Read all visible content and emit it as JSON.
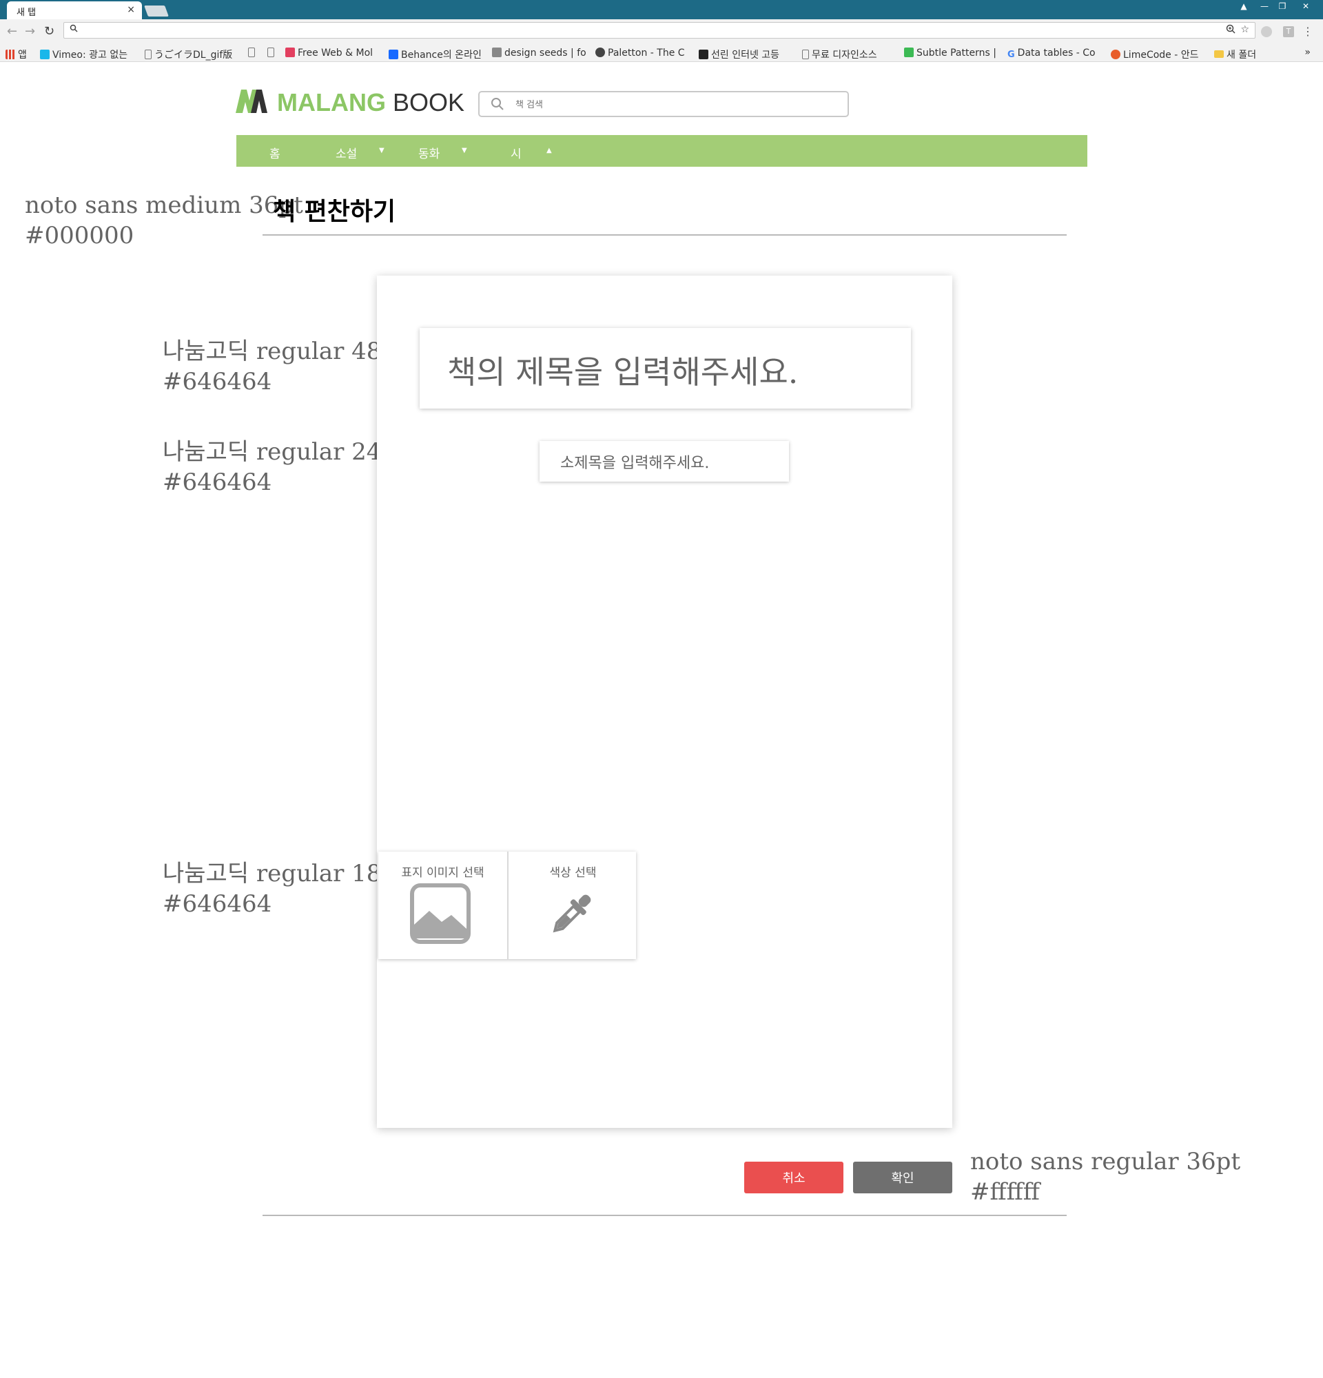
{
  "browser": {
    "tab_title": "새 탭",
    "tab_close": "×",
    "window_controls": [
      "▲",
      "—",
      "❐",
      "✕"
    ],
    "bookmarks": [
      {
        "label": "앱",
        "icon": "apps-grid-icon",
        "color": "#e0442e"
      },
      {
        "label": "Vimeo: 광고 없는",
        "icon": "vimeo-icon",
        "color": "#1ab7ea"
      },
      {
        "label": "うごイラDL_gif版",
        "icon": "page-icon",
        "color": "#ffffff"
      },
      {
        "label": "",
        "icon": "page-icon",
        "color": "#ffffff"
      },
      {
        "label": "Free Web & Mol",
        "icon": "invision-icon",
        "color": "#e23f5f"
      },
      {
        "label": "Behance의 온라인",
        "icon": "behance-icon",
        "color": "#1769ff"
      },
      {
        "label": "design seeds | fo",
        "icon": "design-seeds-icon",
        "color": "#888888"
      },
      {
        "label": "Paletton - The C",
        "icon": "paletton-icon",
        "color": "#444444"
      },
      {
        "label": "선린 인터넷 고등",
        "icon": "sunrin-icon",
        "color": "#222222"
      },
      {
        "label": "무료 디자인소스",
        "icon": "page-icon",
        "color": "#ffffff"
      },
      {
        "label": "Subtle Patterns |",
        "icon": "subtle-patterns-icon",
        "color": "#3cba54"
      },
      {
        "label": "Data tables - Co",
        "icon": "google-icon",
        "color": "#ffffff"
      },
      {
        "label": "LimeCode - 안드",
        "icon": "limecode-icon",
        "color": "#e85d2a"
      },
      {
        "label": "새 폴더",
        "icon": "folder-icon",
        "color": "#f3c745"
      }
    ],
    "bookmarks_overflow": "»"
  },
  "site": {
    "logo_green": "MALANG",
    "logo_dark": "BOOK",
    "search_placeholder": "책 검색",
    "nav": [
      {
        "label": "홈",
        "caret": ""
      },
      {
        "label": "소설",
        "caret": "▼"
      },
      {
        "label": "동화",
        "caret": "▼"
      },
      {
        "label": "시",
        "caret": "▲"
      }
    ]
  },
  "page": {
    "title": "책 편찬하기",
    "book_title_placeholder": "책의 제목을 입력해주세요.",
    "subtitle_placeholder": "소제목을 입력해주세요.",
    "cover_image_label": "표지 이미지 선택",
    "color_label": "색상 선택",
    "cancel_label": "취소",
    "confirm_label": "확인"
  },
  "annotations": {
    "title_font": "noto sans medium 36pt",
    "title_color": "#000000",
    "book_title_font": "나눔고딕 regular 48pt",
    "book_title_color": "#646464",
    "subtitle_font": "나눔고딕 regular 24pt",
    "subtitle_color": "#646464",
    "picker_font": "나눔고딕 regular 18pt",
    "picker_color": "#646464",
    "button_font": "noto sans regular 36pt",
    "button_color": "#ffffff"
  },
  "colors": {
    "chrome_titlebar": "#1d6a86",
    "nav_green": "#a3cd76",
    "logo_green": "#8cc665",
    "cancel_red": "#ea4f4f",
    "confirm_gray": "#6f6f6f",
    "text_gray": "#646464"
  }
}
